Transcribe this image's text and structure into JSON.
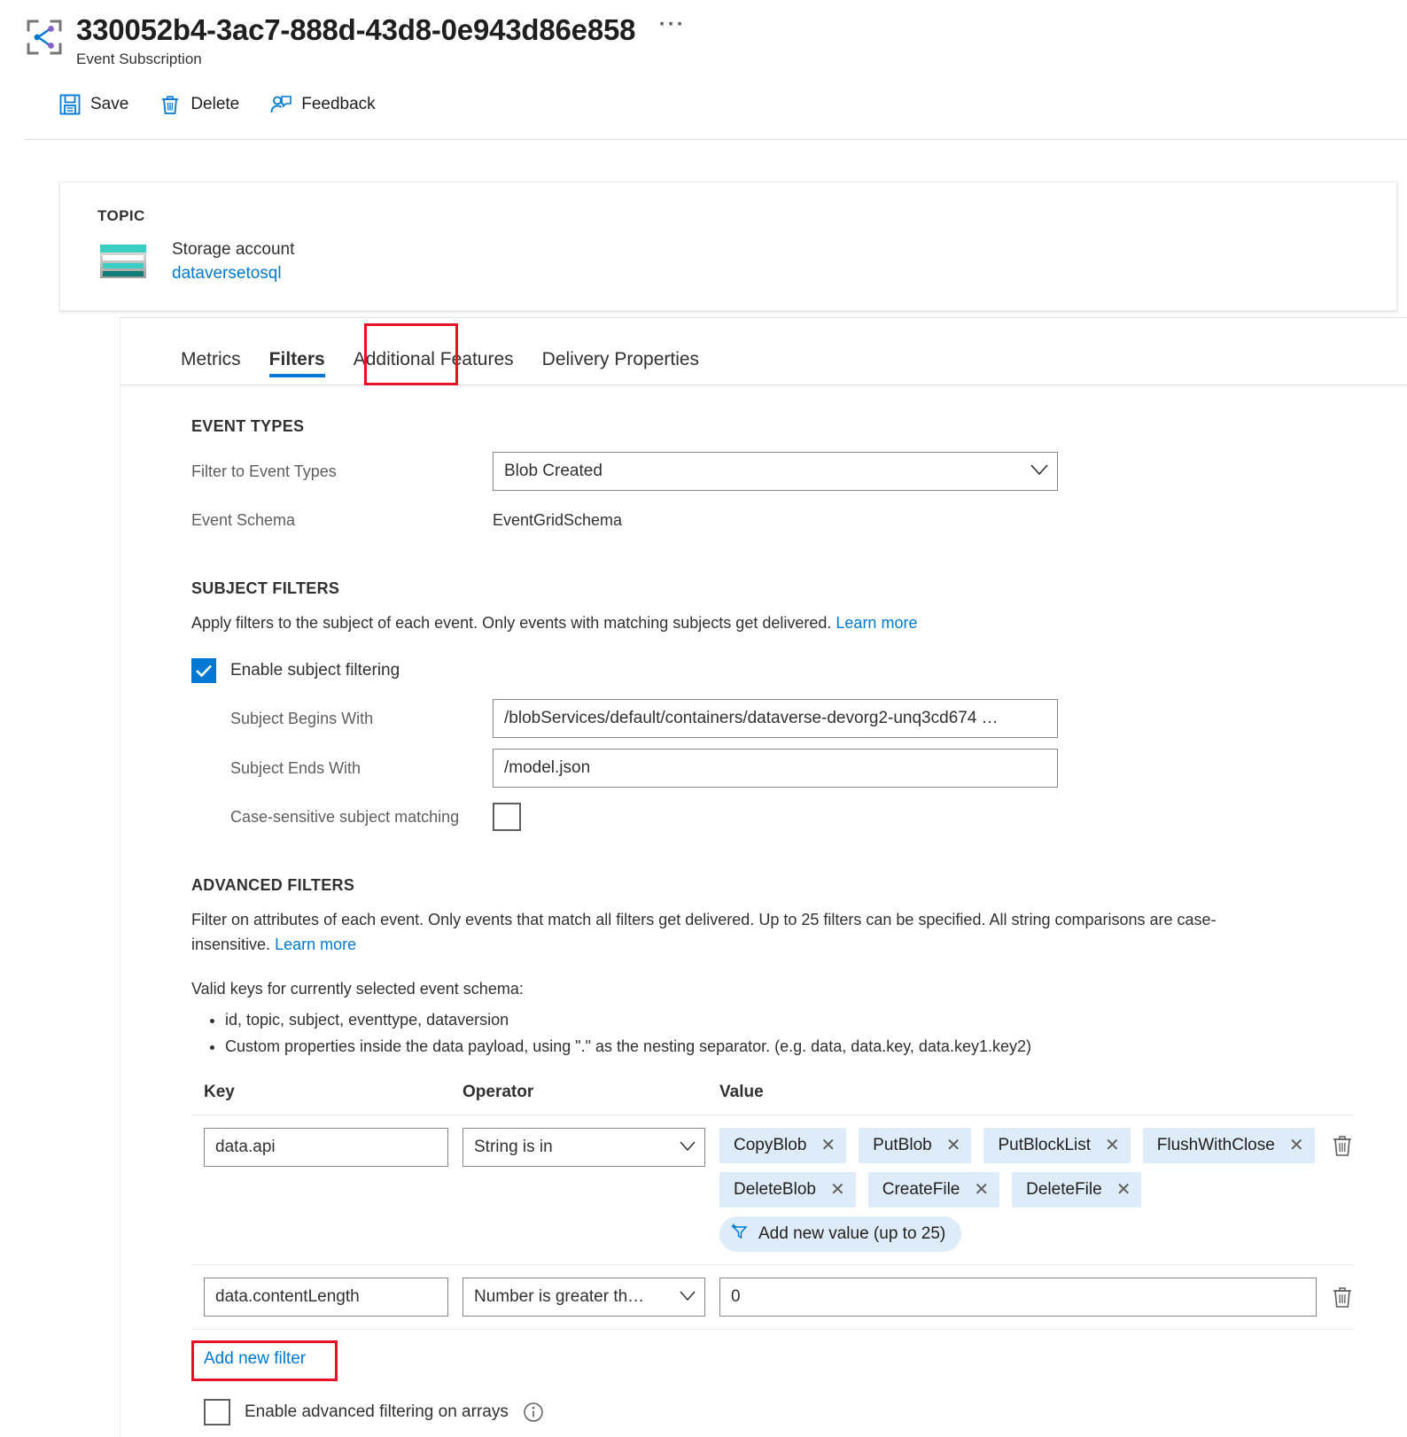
{
  "header": {
    "title": "330052b4-3ac7-888d-43d8-0e943d86e858",
    "subtitle": "Event Subscription",
    "more_label": "···",
    "icon": "event-grid-subscription-icon"
  },
  "commandbar": {
    "items": [
      {
        "label": "Save",
        "icon": "save-icon"
      },
      {
        "label": "Delete",
        "icon": "trash-icon"
      },
      {
        "label": "Feedback",
        "icon": "feedback-person-icon"
      }
    ]
  },
  "topic": {
    "label": "TOPIC",
    "kind": "Storage account",
    "name": "dataversetosql",
    "icon": "storage-account-icon"
  },
  "tabs": [
    {
      "label": "Metrics",
      "active": false
    },
    {
      "label": "Filters",
      "active": true
    },
    {
      "label": "Additional Features",
      "active": false
    },
    {
      "label": "Delivery Properties",
      "active": false
    }
  ],
  "event_types": {
    "heading": "EVENT TYPES",
    "filter_label": "Filter to Event Types",
    "filter_value": "Blob Created",
    "schema_label": "Event Schema",
    "schema_value": "EventGridSchema"
  },
  "subject_filters": {
    "heading": "SUBJECT FILTERS",
    "description": "Apply filters to the subject of each event. Only events with matching subjects get delivered.",
    "learn_more": "Learn more",
    "enable_label": "Enable subject filtering",
    "enable_checked": true,
    "begins_label": "Subject Begins With",
    "begins_value": "/blobServices/default/containers/dataverse-devorg2-unq3cd674 …",
    "ends_label": "Subject Ends With",
    "ends_value": "/model.json",
    "case_label": "Case-sensitive subject matching",
    "case_checked": false
  },
  "advanced_filters": {
    "heading": "ADVANCED FILTERS",
    "description": "Filter on attributes of each event. Only events that match all filters get delivered. Up to 25 filters can be specified. All string comparisons are case-insensitive.",
    "learn_more": "Learn more",
    "valid_keys_intro": "Valid keys for currently selected event schema:",
    "valid_keys": [
      "id, topic, subject, eventtype, dataversion",
      "Custom properties inside the data payload, using \".\" as the nesting separator. (e.g. data, data.key, data.key1.key2)"
    ],
    "columns": {
      "key": "Key",
      "operator": "Operator",
      "value": "Value"
    },
    "rows": [
      {
        "key": "data.api",
        "operator": "String is in",
        "type": "chips",
        "chips": [
          "CopyBlob",
          "PutBlob",
          "PutBlockList",
          "FlushWithClose",
          "DeleteBlob",
          "CreateFile",
          "DeleteFile"
        ],
        "add_value_label": "Add new value (up to 25)"
      },
      {
        "key": "data.contentLength",
        "operator": "Number is greater th…",
        "type": "text",
        "value": "0"
      }
    ],
    "add_filter_label": "Add new filter",
    "arrays_label": "Enable advanced filtering on arrays",
    "arrays_checked": false
  },
  "colors": {
    "accent": "#0078d4",
    "annotation": "#e81123",
    "chip_bg": "#deecf9",
    "teal": "#3bcfc3",
    "teal_dark": "#107c76"
  }
}
